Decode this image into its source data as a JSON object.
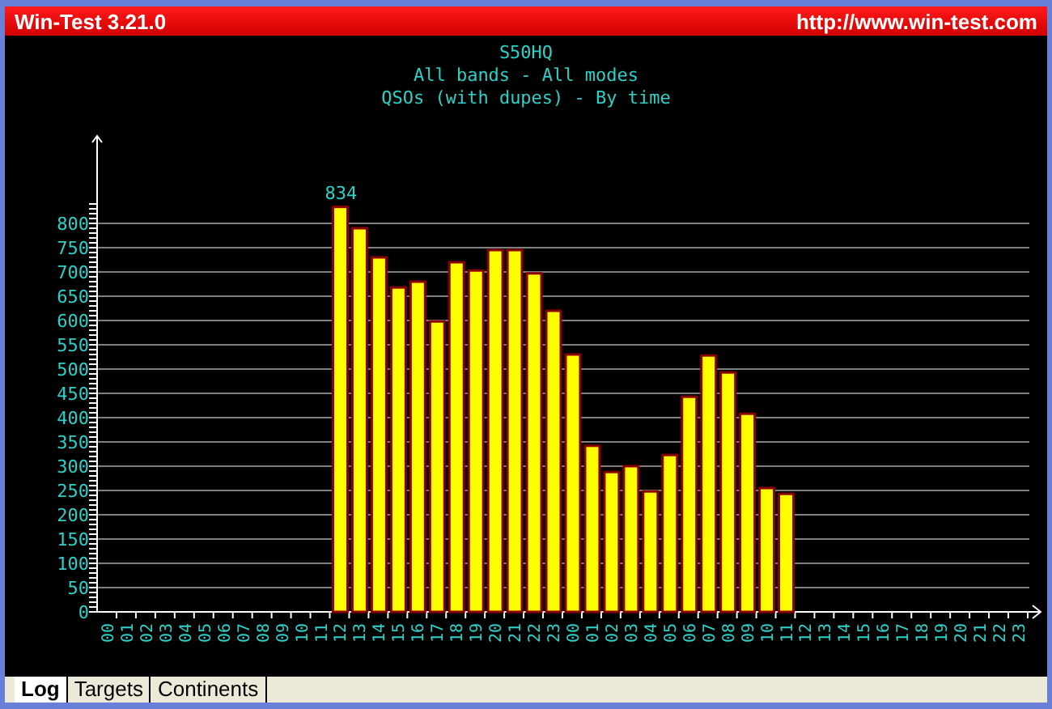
{
  "window": {
    "title": "Win-Test 3.21.0",
    "url": "http://www.win-test.com"
  },
  "chart": {
    "titles": [
      "S50HQ",
      "All bands - All modes",
      "QSOs (with dupes) - By time"
    ],
    "chart_data": {
      "type": "bar",
      "categories": [
        "00",
        "01",
        "02",
        "03",
        "04",
        "05",
        "06",
        "07",
        "08",
        "09",
        "10",
        "11",
        "12",
        "13",
        "14",
        "15",
        "16",
        "17",
        "18",
        "19",
        "20",
        "21",
        "22",
        "23",
        "00",
        "01",
        "02",
        "03",
        "04",
        "05",
        "06",
        "07",
        "08",
        "09",
        "10",
        "11",
        "12",
        "13",
        "14",
        "15",
        "16",
        "17",
        "18",
        "19",
        "20",
        "21",
        "22",
        "23"
      ],
      "series": [
        {
          "color": "#ffff00",
          "values": [
            0,
            0,
            0,
            0,
            0,
            0,
            0,
            0,
            0,
            0,
            0,
            0,
            834,
            790,
            730,
            668,
            680,
            598,
            720,
            703,
            745,
            745,
            697,
            620,
            530,
            342,
            288,
            300,
            248,
            323,
            443,
            528,
            493,
            408,
            255,
            243,
            0,
            0,
            0,
            0,
            0,
            0,
            0,
            0,
            0,
            0,
            0,
            0
          ]
        }
      ],
      "ylim": [
        0,
        980
      ],
      "grid": true,
      "yticks": [
        0,
        50,
        100,
        150,
        200,
        250,
        300,
        350,
        400,
        450,
        500,
        550,
        600,
        650,
        700,
        750,
        800
      ],
      "annotations": [
        {
          "x": "12",
          "y": 834,
          "text": "834"
        }
      ]
    }
  },
  "tabs": [
    {
      "label": "Log",
      "selected": true
    },
    {
      "label": "Targets",
      "selected": false
    },
    {
      "label": "Continents",
      "selected": false
    }
  ]
}
